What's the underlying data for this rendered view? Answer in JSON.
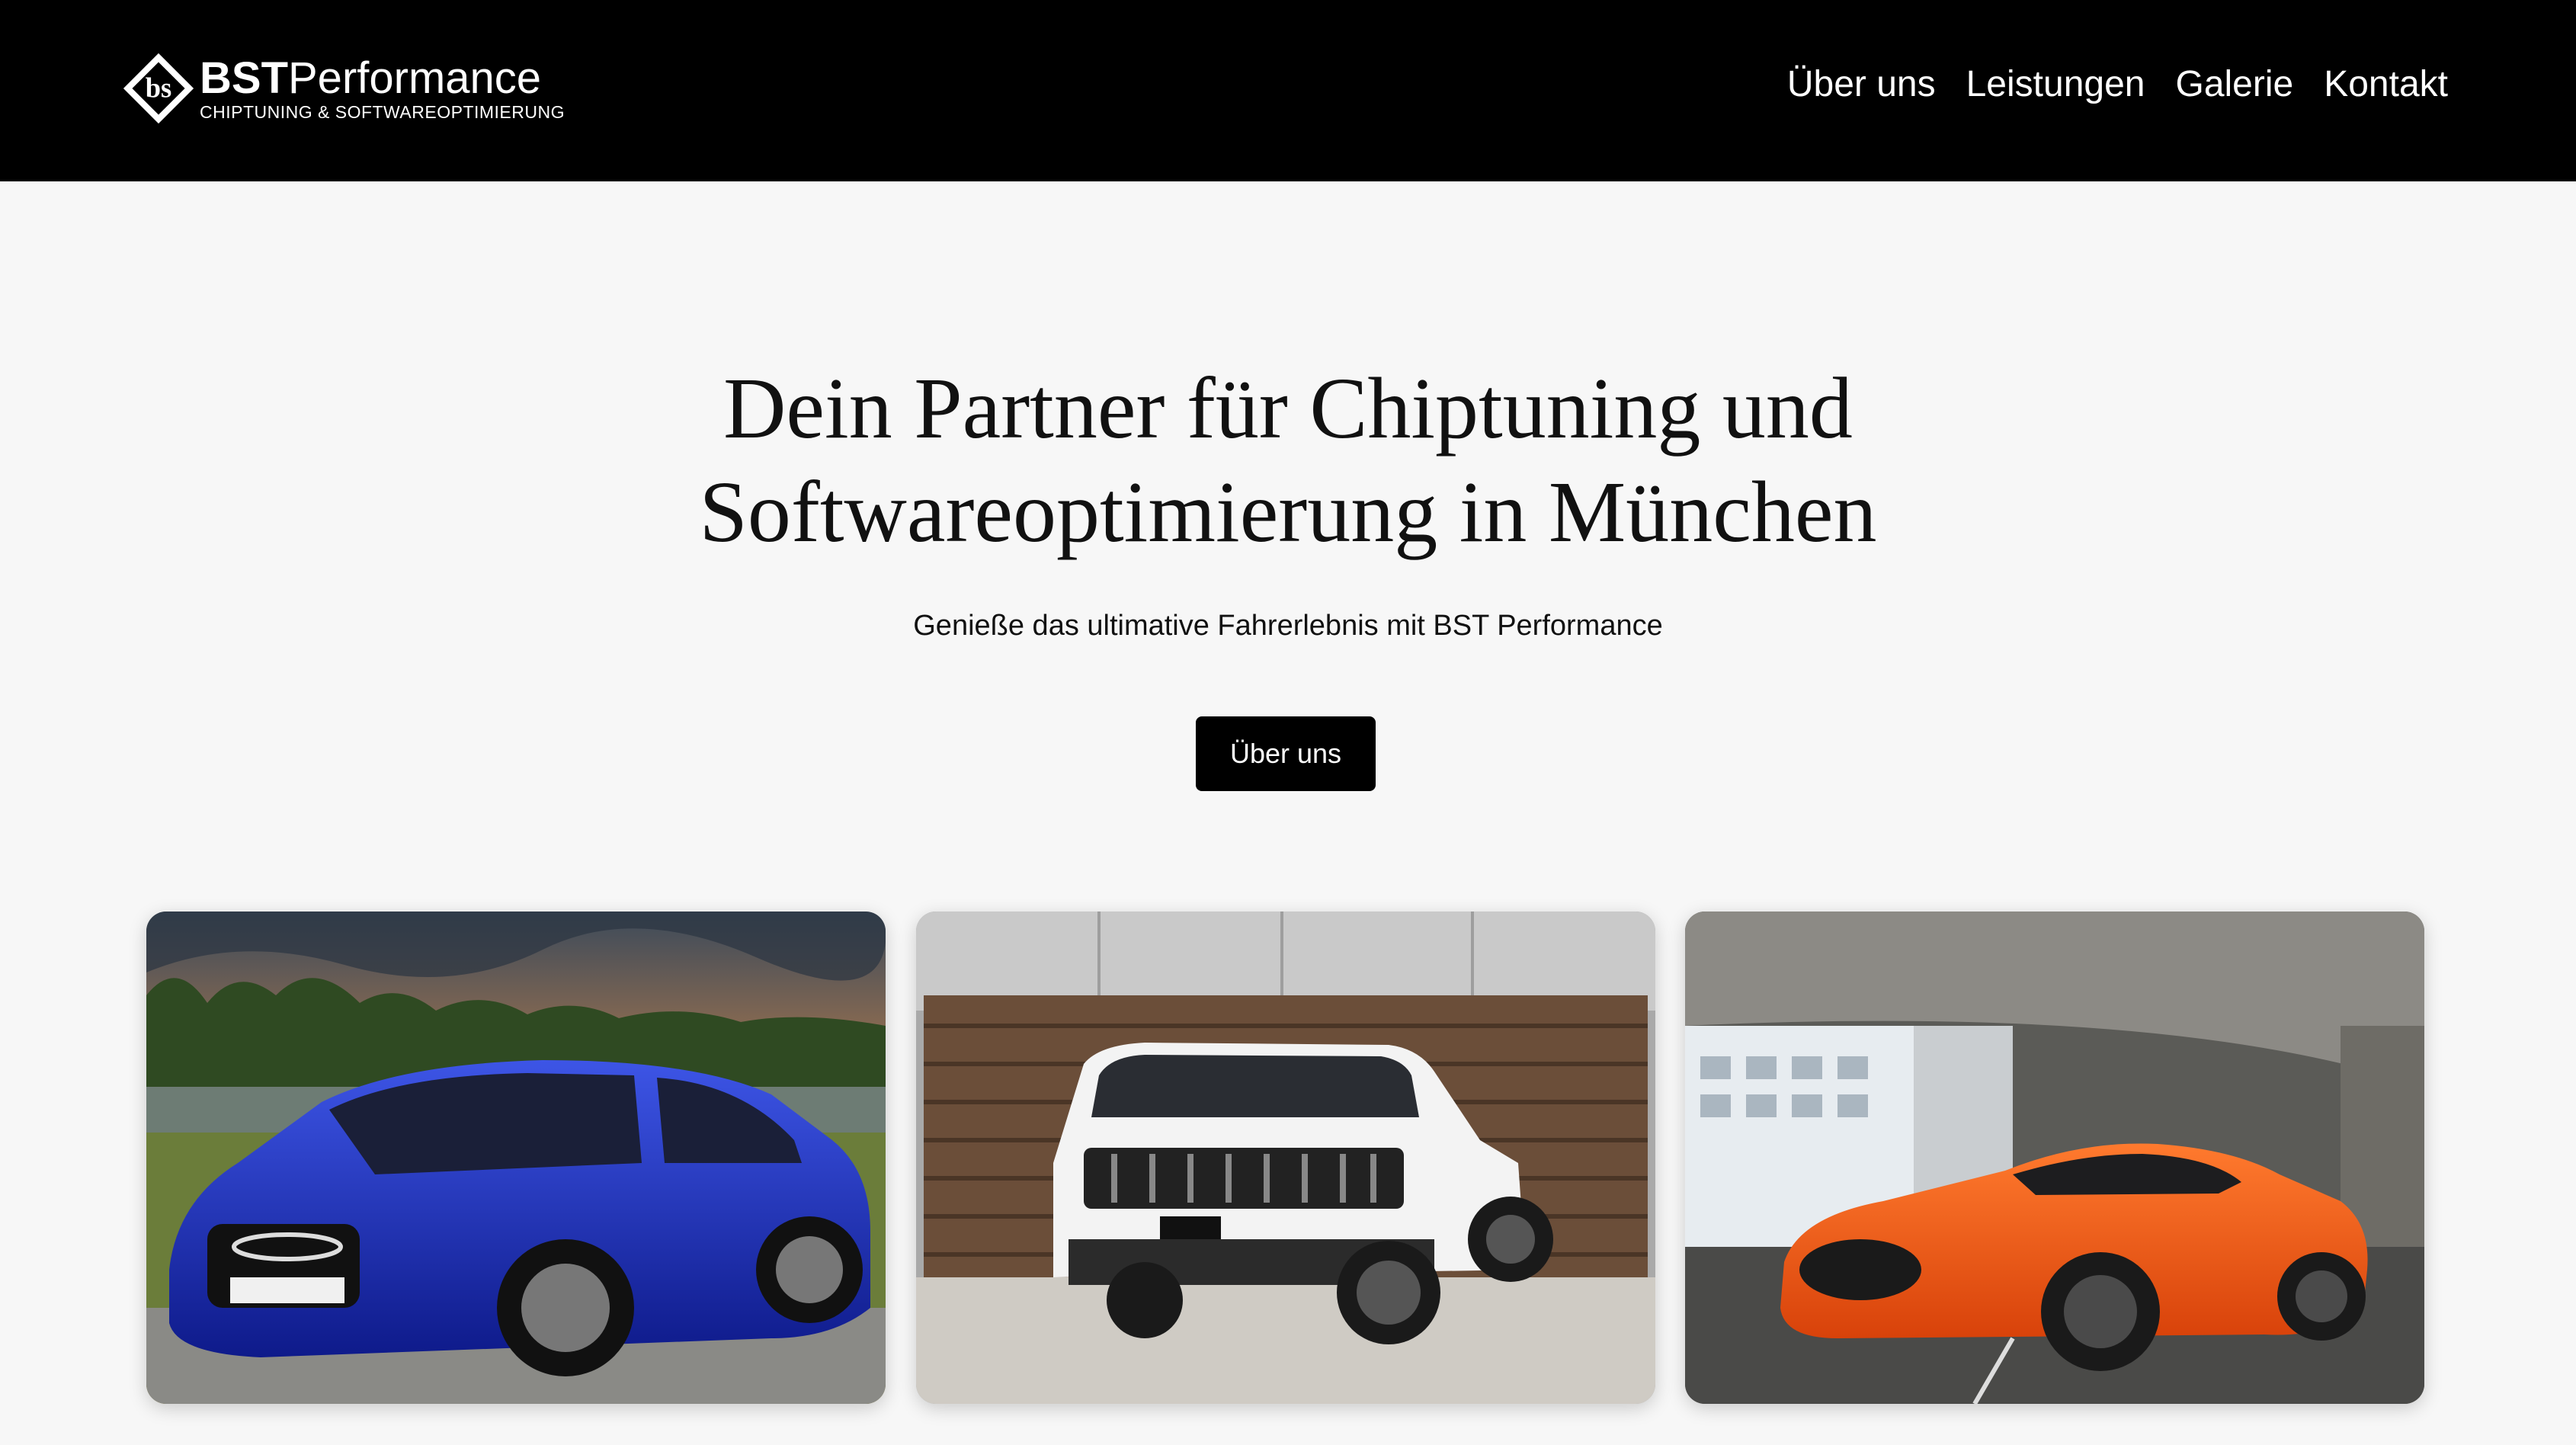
{
  "header": {
    "brand_strong": "BST",
    "brand_light": "Performance",
    "brand_tagline": "CHIPTUNING & SOFTWAREOPTIMIERUNG",
    "logo_icon": "bst-diamond-logo",
    "nav": [
      {
        "label": "Über uns"
      },
      {
        "label": "Leistungen"
      },
      {
        "label": "Galerie"
      },
      {
        "label": "Kontakt"
      }
    ]
  },
  "hero": {
    "title_line1": "Dein Partner für Chiptuning und",
    "title_line2": "Softwareoptimierung in München",
    "subtitle": "Genieße das ultimative Fahrerlebnis mit BST Performance",
    "button_label": "Über uns"
  },
  "gallery": [
    {
      "subject": "blue-audi-rs6-avant",
      "color": "#1d2fb8"
    },
    {
      "subject": "white-jeep-grand-cherokee",
      "color": "#f2f2f2"
    },
    {
      "subject": "orange-jaguar-f-type",
      "color": "#ff5a14"
    }
  ],
  "colors": {
    "header_bg": "#000000",
    "page_bg": "#f7f7f7",
    "button_bg": "#000000",
    "button_text": "#ffffff"
  }
}
